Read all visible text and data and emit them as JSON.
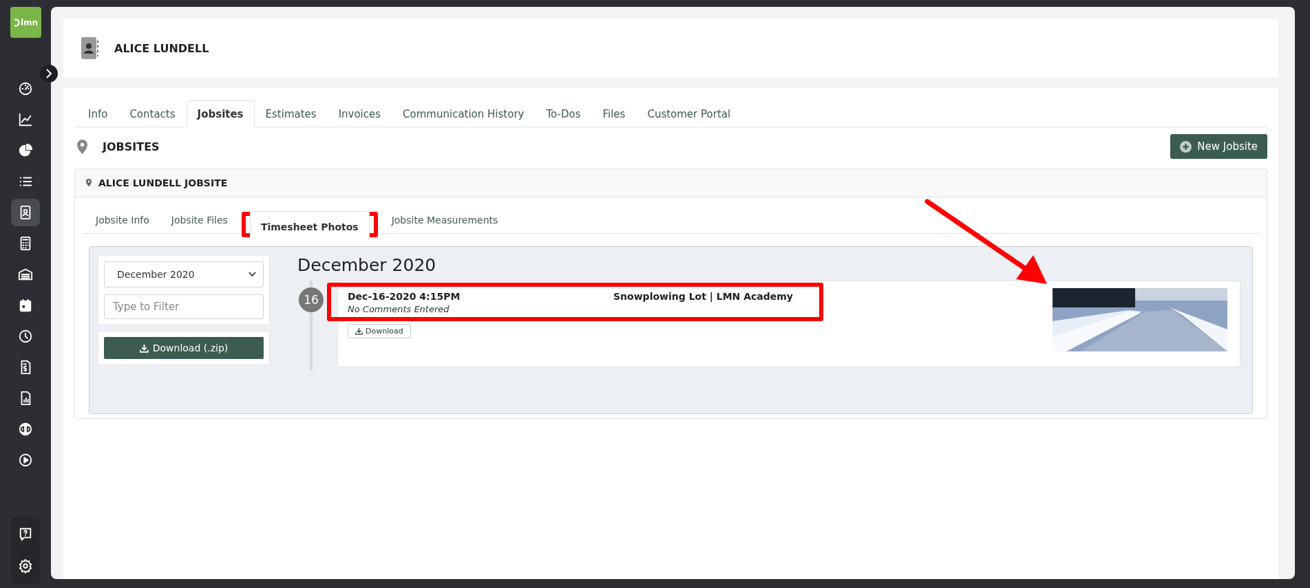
{
  "sidebar": {
    "logo": "lmn",
    "items": [
      {
        "selected": false
      },
      {
        "selected": false
      },
      {
        "selected": false
      },
      {
        "selected": false
      },
      {
        "selected": true
      },
      {
        "selected": false
      },
      {
        "selected": false
      },
      {
        "selected": false
      },
      {
        "selected": false
      },
      {
        "selected": false
      },
      {
        "selected": false
      },
      {
        "selected": false
      },
      {
        "selected": false
      }
    ],
    "footer_items": [
      {
        "selected": false
      },
      {
        "selected": false
      }
    ]
  },
  "customer": {
    "name": "ALICE LUNDELL"
  },
  "tabs": [
    {
      "label": "Info",
      "selected": false
    },
    {
      "label": "Contacts",
      "selected": false
    },
    {
      "label": "Jobsites",
      "selected": true
    },
    {
      "label": "Estimates",
      "selected": false
    },
    {
      "label": "Invoices",
      "selected": false
    },
    {
      "label": "Communication History",
      "selected": false
    },
    {
      "label": "To-Dos",
      "selected": false
    },
    {
      "label": "Files",
      "selected": false
    },
    {
      "label": "Customer Portal",
      "selected": false
    }
  ],
  "section": {
    "title": "JOBSITES",
    "button": "New Jobsite"
  },
  "jobsite": {
    "title": "ALICE LUNDELL JOBSITE",
    "tabs": [
      {
        "label": "Jobsite Info",
        "selected": false,
        "highlighted": false
      },
      {
        "label": "Jobsite Files",
        "selected": false,
        "highlighted": false
      },
      {
        "label": "Timesheet Photos",
        "selected": true,
        "highlighted": true
      },
      {
        "label": "Jobsite Measurements",
        "selected": false,
        "highlighted": false
      }
    ],
    "filter": {
      "month": "December 2020",
      "placeholder": "Type to Filter",
      "download": "Download (.zip)"
    },
    "group_title": "December 2020",
    "entries": [
      {
        "day": "16",
        "datetime": "Dec-16-2020 4:15PM",
        "title": "Snowplowing Lot | LMN Academy",
        "comment": "No Comments Entered",
        "download": "Download",
        "highlighted": true,
        "photo_pointed": true
      }
    ]
  }
}
